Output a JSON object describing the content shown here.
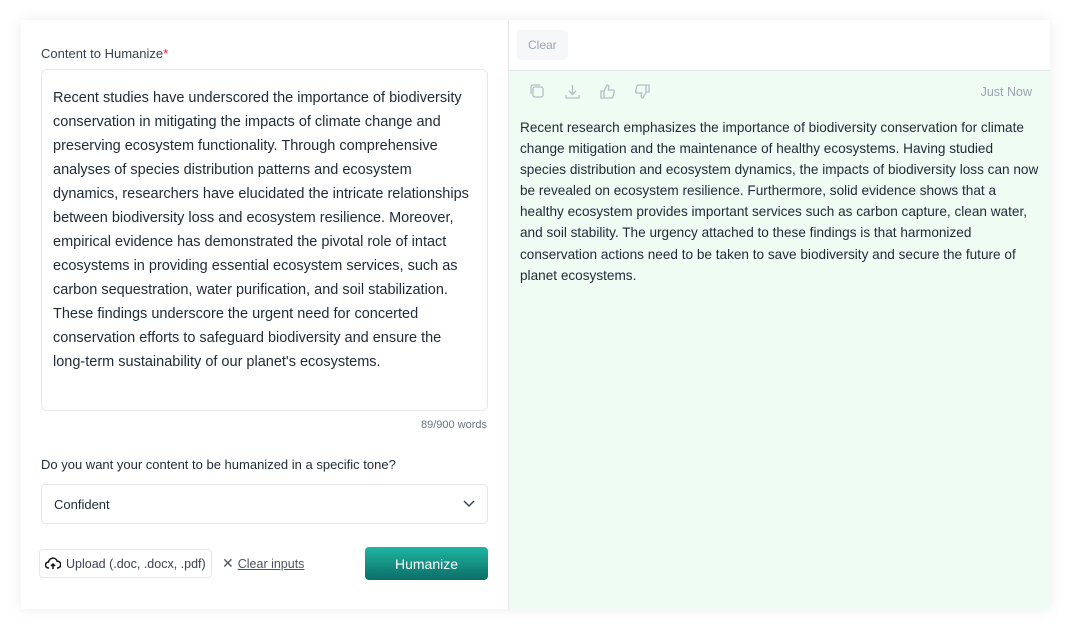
{
  "input": {
    "label": "Content to Humanize",
    "required_mark": "*",
    "text": "Recent studies have underscored the importance of biodiversity conservation in mitigating the impacts of climate change and preserving ecosystem functionality. Through comprehensive analyses of species distribution patterns and ecosystem dynamics, researchers have elucidated the intricate relationships between biodiversity loss and ecosystem resilience. Moreover, empirical evidence has demonstrated the pivotal role of intact ecosystems in providing essential ecosystem services, such as carbon sequestration, water purification, and soil stabilization. These findings underscore the urgent need for concerted conservation efforts to safeguard biodiversity and ensure the long-term sustainability of our planet's ecosystems.",
    "word_count": "89/900 words"
  },
  "tone": {
    "question": "Do you want your content to be humanized in a specific tone?",
    "selected": "Confident"
  },
  "actions": {
    "upload": "Upload (.doc, .docx, .pdf)",
    "clear_inputs": "Clear inputs",
    "humanize": "Humanize"
  },
  "output": {
    "clear": "Clear",
    "timestamp": "Just Now",
    "icons": [
      "copy-icon",
      "download-icon",
      "thumbs-up-icon",
      "thumbs-down-icon"
    ],
    "text": "Recent research emphasizes the importance of biodiversity conservation for climate change mitigation and the maintenance of healthy ecosystems. Having studied species distribution and ecosystem dynamics, the impacts of biodiversity loss can now be revealed on ecosystem resilience. Furthermore, solid evidence shows that a healthy ecosystem provides important services such as carbon capture, clean water, and soil stability. The urgency attached to these findings is that harmonized conservation actions need to be taken to save biodiversity and secure the future of planet ecosystems."
  },
  "colors": {
    "accent": "#139688",
    "output_bg": "#effcf3"
  }
}
